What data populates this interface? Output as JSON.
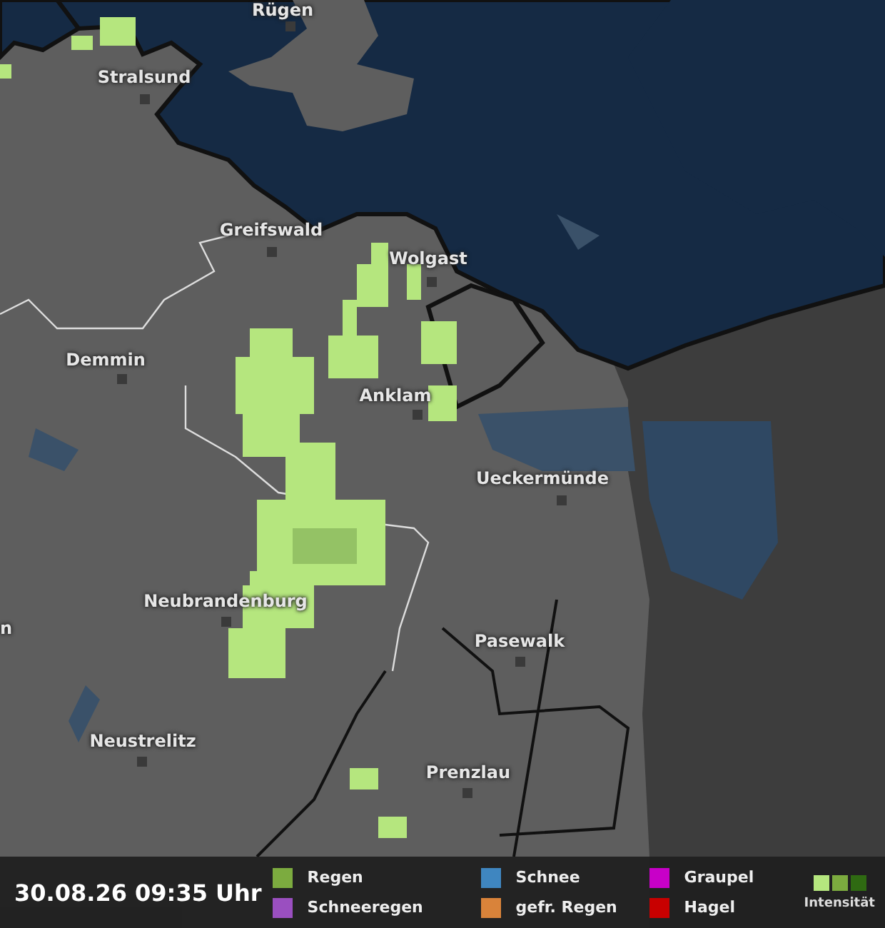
{
  "map": {
    "cities": [
      {
        "name": "Rügen"
      },
      {
        "name": "Stralsund"
      },
      {
        "name": "Greifswald"
      },
      {
        "name": "Wolgast"
      },
      {
        "name": "Demmin"
      },
      {
        "name": "Anklam"
      },
      {
        "name": "Ueckermünde"
      },
      {
        "name": "Neubrandenburg"
      },
      {
        "name": "n"
      },
      {
        "name": "Pasewalk"
      },
      {
        "name": "Neustrelitz"
      },
      {
        "name": "Prenzlau"
      }
    ]
  },
  "timestamp": "30.08.26 09:35 Uhr",
  "legend": [
    {
      "label": "Regen",
      "color": "#7cab3f"
    },
    {
      "label": "Schneeregen",
      "color": "#9a4fc0"
    },
    {
      "label": "Schnee",
      "color": "#3f86c0"
    },
    {
      "label": "gefr. Regen",
      "color": "#d9833a"
    },
    {
      "label": "Graupel",
      "color": "#c800c8"
    },
    {
      "label": "Hagel",
      "color": "#c80000"
    }
  ],
  "intensity": {
    "label": "Intensität",
    "colors": [
      {
        "color": "#b5e67e"
      },
      {
        "color": "#7cab3f"
      },
      {
        "color": "#2f6a12"
      }
    ]
  }
}
